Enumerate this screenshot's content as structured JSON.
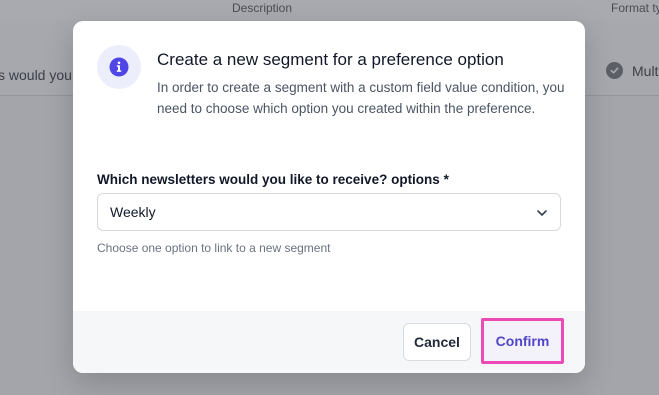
{
  "background": {
    "column_description": "Description",
    "column_format": "Format ty",
    "row_text": "s would you",
    "format_text": "Mult"
  },
  "modal": {
    "title": "Create a new segment for a preference option",
    "description": "In order to create a segment with a custom field value condition, you need to choose which option you created within the preference.",
    "field_label": "Which newsletters would you like to receive? options *",
    "select_value": "Weekly",
    "help_text": "Choose one option to link to a new segment",
    "cancel_label": "Cancel",
    "confirm_label": "Confirm",
    "icon": "info-icon"
  },
  "colors": {
    "accent": "#5046c8",
    "highlight_border": "#ec4bb6"
  }
}
